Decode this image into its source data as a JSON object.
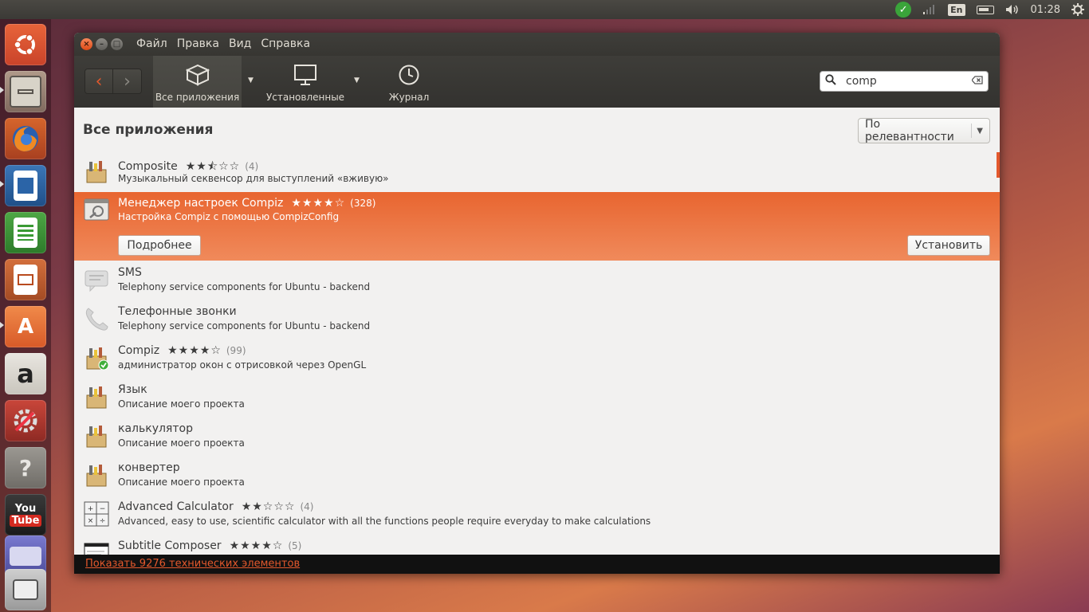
{
  "top_panel": {
    "language": "En",
    "time": "01:28",
    "icons": [
      "update-check-icon",
      "network-icon",
      "keyboard-layout-icon",
      "battery-icon",
      "volume-icon",
      "gear-icon"
    ]
  },
  "launcher": {
    "items": [
      "ubuntu-dash",
      "files",
      "firefox",
      "writer",
      "calc",
      "impress",
      "software-center",
      "amazon",
      "system-settings",
      "help",
      "youtube",
      "workspace-switcher",
      "trash"
    ],
    "youtube_label_1": "You",
    "youtube_label_2": "Tube",
    "help_label": "?",
    "amazon_label": "a",
    "softwarecenter_label": "A"
  },
  "window": {
    "menu": [
      "Файл",
      "Правка",
      "Вид",
      "Справка"
    ],
    "toolbar": {
      "all_apps": "Все приложения",
      "installed": "Установленные",
      "history": "Журнал"
    },
    "search": {
      "value": "comp"
    },
    "page_title": "Все приложения",
    "sort": {
      "selected": "По релевантности"
    },
    "apps": [
      {
        "name": "Composite",
        "stars": "★★⯪☆☆",
        "count": "(4)",
        "desc": "Музыкальный секвенсор для выступлений «вживую»"
      },
      {
        "name": "Менеджер настроек Compiz",
        "stars": "★★★★☆",
        "count": "(328)",
        "desc": "Настройка Compiz с помощью CompizConfig",
        "details_label": "Подробнее",
        "install_label": "Установить"
      },
      {
        "name": "SMS",
        "stars": "",
        "count": "",
        "desc": "Telephony service components for Ubuntu - backend"
      },
      {
        "name": "Телефонные звонки",
        "stars": "",
        "count": "",
        "desc": "Telephony service components for Ubuntu - backend"
      },
      {
        "name": "Compiz",
        "stars": "★★★★☆",
        "count": "(99)",
        "desc": "администратор окон с отрисовкой через OpenGL"
      },
      {
        "name": "Язык",
        "stars": "",
        "count": "",
        "desc": "Описание моего проекта"
      },
      {
        "name": "калькулятор",
        "stars": "",
        "count": "",
        "desc": "Описание моего проекта"
      },
      {
        "name": "конвертер",
        "stars": "",
        "count": "",
        "desc": "Описание моего проекта"
      },
      {
        "name": "Advanced Calculator",
        "stars": "★★☆☆☆",
        "count": "(4)",
        "desc": "Advanced, easy to use, scientific calculator with all the functions people require everyday to make calculations"
      },
      {
        "name": "Subtitle Composer",
        "stars": "★★★★☆",
        "count": "(5)",
        "desc": ""
      }
    ],
    "footer_link": "Показать 9276 технических элементов"
  },
  "colors": {
    "accent": "#e3582c",
    "selected_row": "#ec7443",
    "panel": "#3b3a36"
  }
}
